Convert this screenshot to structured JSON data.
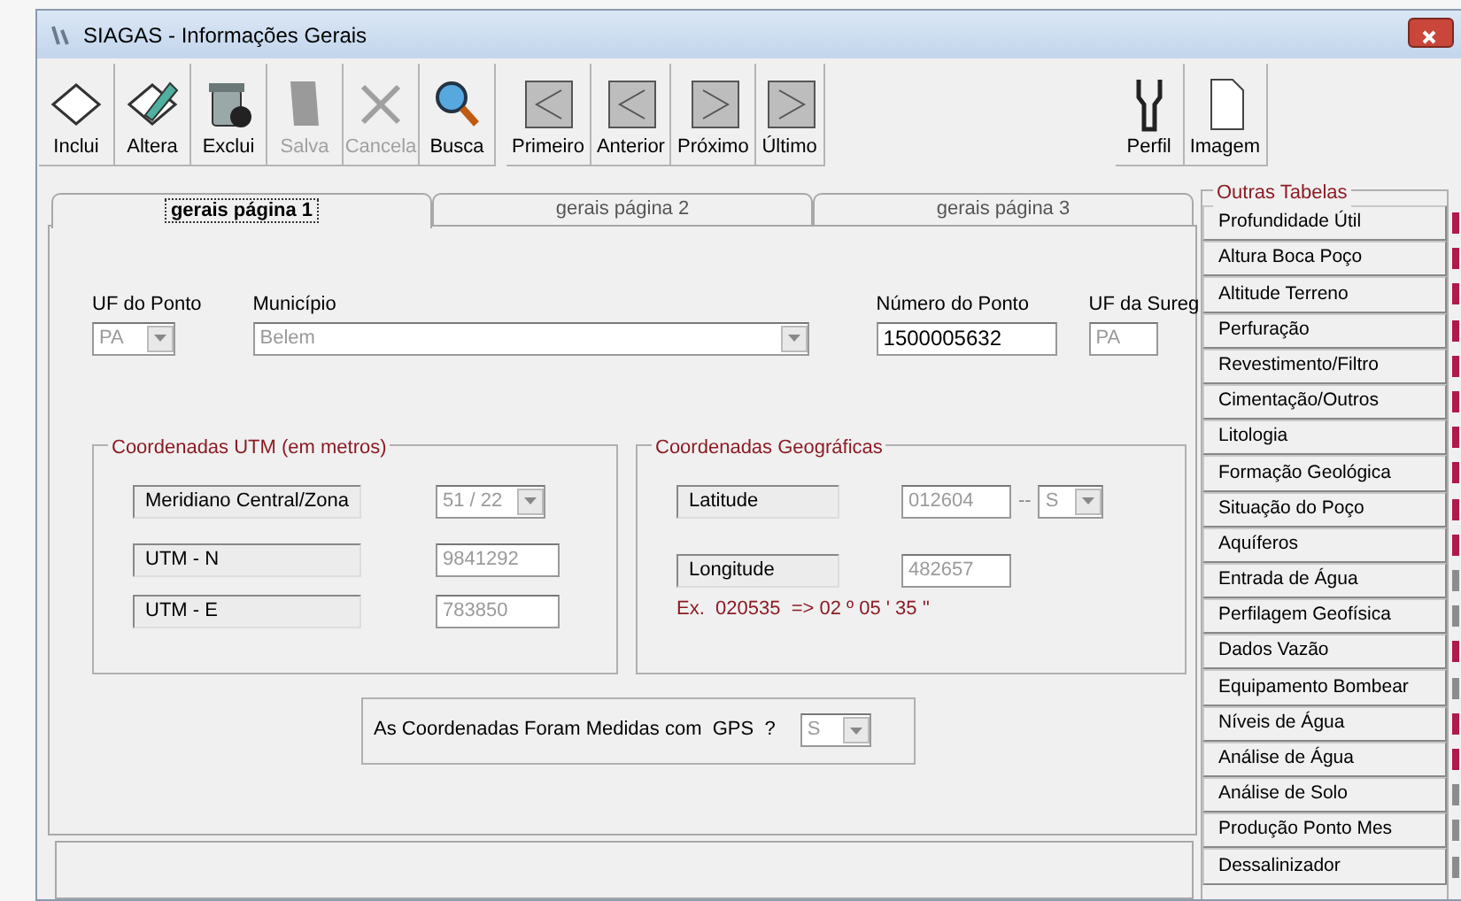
{
  "window": {
    "title": "SIAGAS - Informações Gerais"
  },
  "toolbar": {
    "record_buttons": [
      {
        "label": "Inclui",
        "kind": "new",
        "disabled": false
      },
      {
        "label": "Altera",
        "kind": "edit",
        "disabled": false
      },
      {
        "label": "Exclui",
        "kind": "delete",
        "disabled": false
      },
      {
        "label": "Salva",
        "kind": "save",
        "disabled": true
      },
      {
        "label": "Cancela",
        "kind": "cancel",
        "disabled": true
      },
      {
        "label": "Busca",
        "kind": "search",
        "disabled": false
      }
    ],
    "navigation_buttons": [
      {
        "label": "Primeiro",
        "kind": "back",
        "disabled": false
      },
      {
        "label": "Anterior",
        "kind": "back",
        "disabled": false
      },
      {
        "label": "Próximo",
        "kind": "forward",
        "disabled": false
      },
      {
        "label": "Último",
        "kind": "forward",
        "disabled": false
      }
    ],
    "tool_buttons": [
      {
        "label": "Perfil",
        "kind": "profile",
        "disabled": false
      },
      {
        "label": "Imagem",
        "kind": "page",
        "disabled": false
      }
    ]
  },
  "tabs": [
    {
      "label": "gerais página 1",
      "selected": true
    },
    {
      "label": "gerais página 2",
      "selected": false
    },
    {
      "label": "gerais página 3",
      "selected": false
    }
  ],
  "fields": [
    {
      "label": "UF do Ponto",
      "value": "PA",
      "kind": "combo",
      "disabled": true
    },
    {
      "label": "Município",
      "value": "Belem",
      "kind": "combo",
      "disabled": true
    },
    {
      "label": "Número do Ponto",
      "value": "1500005632",
      "kind": "text",
      "disabled": false
    },
    {
      "label": "UF da Sureg",
      "value": "PA",
      "kind": "text",
      "disabled": true
    }
  ],
  "utm": {
    "title": "Coordenadas UTM (em metros)",
    "rows": [
      {
        "label": "Meridiano Central/Zona",
        "value": "51 / 22",
        "kind": "combo",
        "disabled": true
      },
      {
        "label": "UTM - N",
        "value": "9841292",
        "kind": "text",
        "disabled": true
      },
      {
        "label": "UTM - E",
        "value": "783850",
        "kind": "text",
        "disabled": true
      }
    ]
  },
  "geo": {
    "title": "Coordenadas Geográficas",
    "latitude": {
      "label": "Latitude",
      "value": "012604",
      "separator": "--",
      "hemisphere": "S",
      "disabled": true
    },
    "longitude": {
      "label": "Longitude",
      "value": "482657",
      "disabled": true
    },
    "example": "Ex.  020535  => 02 º 05 ' 35 ''"
  },
  "gps": {
    "label": "As Coordenadas Foram Medidas com  GPS  ?",
    "value": "S",
    "disabled": true
  },
  "other_tables": {
    "title": "Outras Tabelas",
    "items": [
      {
        "label": "Profundidade Útil",
        "color": "#b0184e"
      },
      {
        "label": "Altura Boca Poço",
        "color": "#b0184e"
      },
      {
        "label": "Altitude Terreno",
        "color": "#b0184e"
      },
      {
        "label": "Perfuração",
        "color": "#b0184e"
      },
      {
        "label": "Revestimento/Filtro",
        "color": "#b0184e"
      },
      {
        "label": "Cimentação/Outros",
        "color": "#b0184e"
      },
      {
        "label": "Litologia",
        "color": "#b0184e"
      },
      {
        "label": "Formação Geológica",
        "color": "#b0184e"
      },
      {
        "label": "Situação do Poço",
        "color": "#b0184e"
      },
      {
        "label": "Aquíferos",
        "color": "#b0184e"
      },
      {
        "label": "Entrada de Água",
        "color": "#8c8c8c"
      },
      {
        "label": "Perfilagem Geofísica",
        "color": "#8c8c8c"
      },
      {
        "label": "Dados Vazão",
        "color": "#b0184e"
      },
      {
        "label": "Equipamento Bombear",
        "color": "#8c8c8c"
      },
      {
        "label": "Níveis de Água",
        "color": "#b0184e"
      },
      {
        "label": "Análise de Água",
        "color": "#b0184e"
      },
      {
        "label": "Análise de Solo",
        "color": "#8c8c8c"
      },
      {
        "label": "Produção Ponto Mes",
        "color": "#8c8c8c"
      },
      {
        "label": "Dessalinizador",
        "color": "#8c8c8c"
      }
    ]
  }
}
